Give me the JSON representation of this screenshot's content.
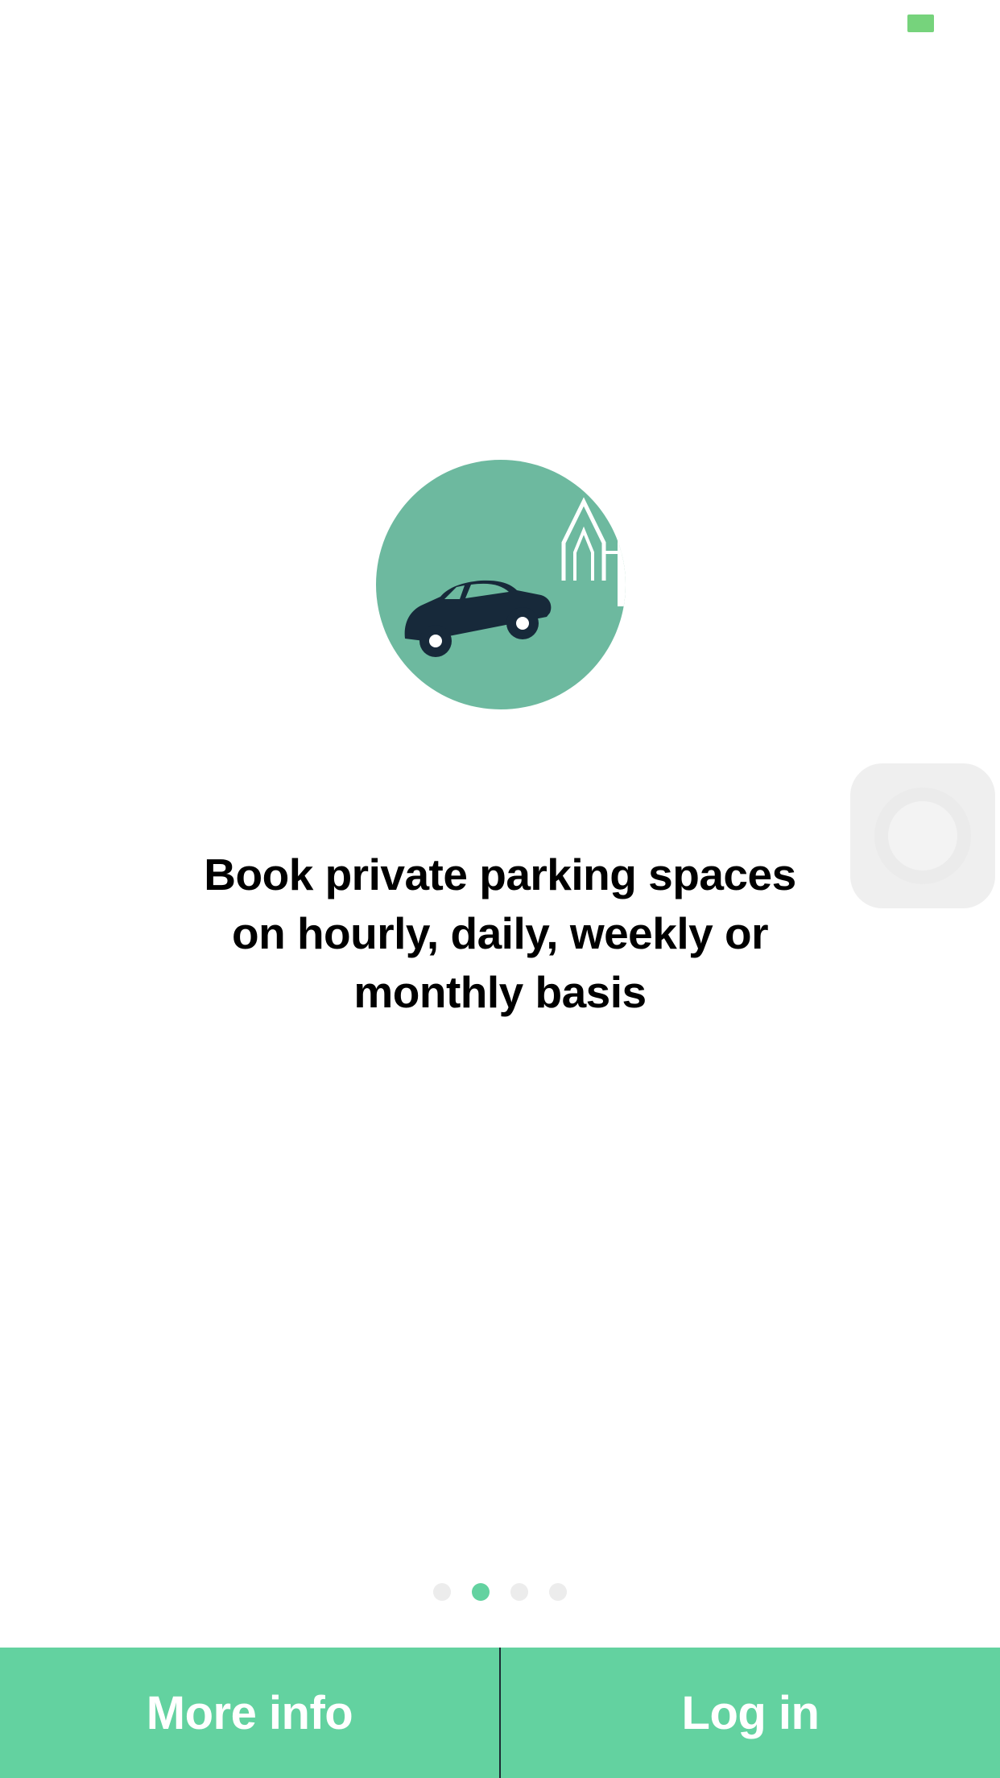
{
  "colors": {
    "accent": "#63d2a0",
    "hero_circle": "#6db99f",
    "car": "#17293a",
    "battery": "#76d37c",
    "pager_active": "#63d2a0",
    "pager_inactive": "#ececec"
  },
  "status_bar": {
    "battery_icon": "battery-icon"
  },
  "hero": {
    "icon": "car-parking-illustration"
  },
  "headline": "Book private parking spaces\non hourly, daily, weekly or\nmonthly basis",
  "pager": {
    "total": 4,
    "active_index": 1
  },
  "bottom_bar": {
    "more_info_label": "More info",
    "log_in_label": "Log in"
  }
}
